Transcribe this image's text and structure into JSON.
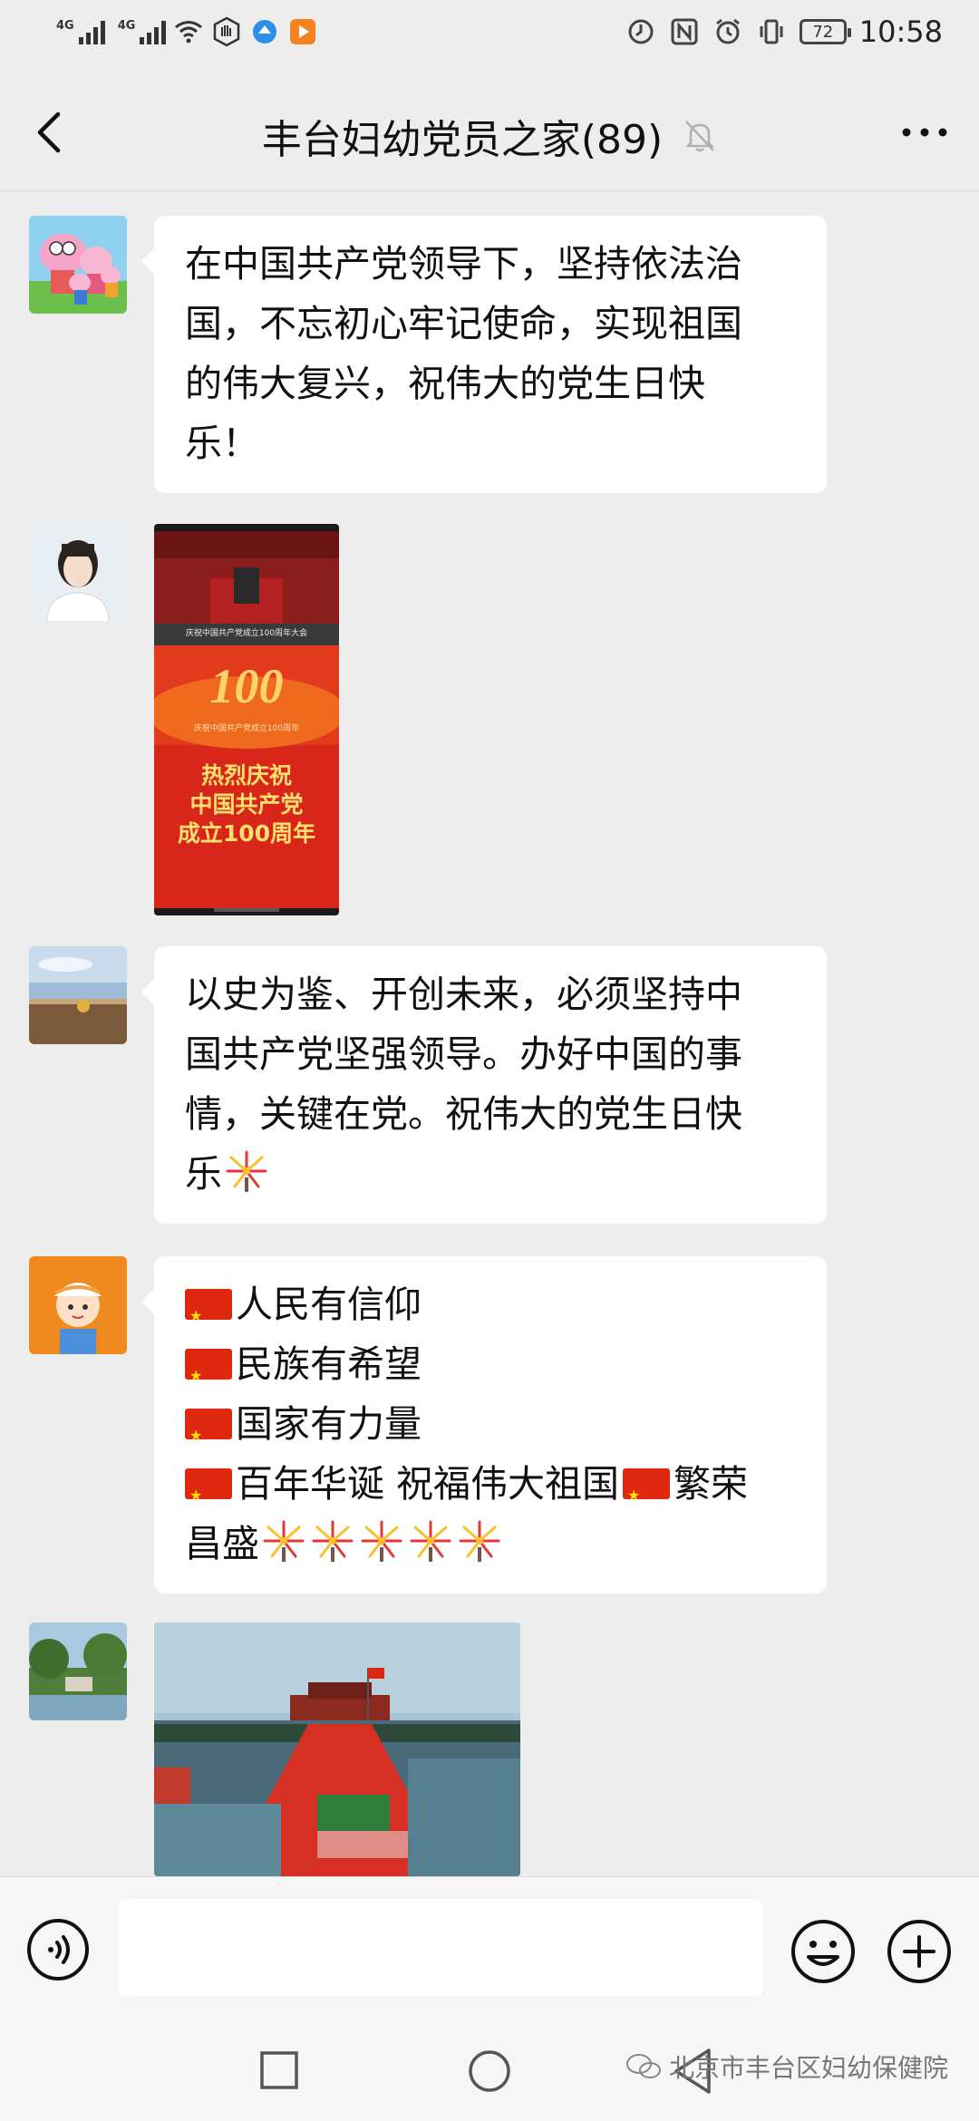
{
  "status_bar": {
    "signal1_label": "4G",
    "signal2_label": "4G",
    "battery": "72",
    "time": "10:58"
  },
  "header": {
    "title": "丰台妇幼党员之家(89)"
  },
  "messages": [
    {
      "type": "text",
      "lines": [
        "在中国共产党领导下，坚持依法治",
        "国，不忘初心牢记使命，实现祖国",
        "的伟大复兴，祝伟大的党生日快",
        "乐！"
      ]
    },
    {
      "type": "image",
      "image": {
        "top_caption": "庆祝中国共产党成立100周年大会",
        "badge": "100",
        "small_text": "庆祝中国共产党成立100周年",
        "headline_lines": [
          "热烈庆祝",
          "中国共产党",
          "成立100周年"
        ]
      }
    },
    {
      "type": "text",
      "lines": [
        "以史为鉴、开创未来，必须坚持中",
        "国共产党坚强领导。办好中国的事",
        "情，关键在党。祝伟大的党生日快",
        "乐"
      ]
    },
    {
      "type": "text",
      "lines": [
        "人民有信仰",
        "民族有希望",
        "国家有力量",
        "百年华诞  祝福伟大祖国",
        "繁荣",
        "昌盛"
      ]
    },
    {
      "type": "image",
      "image": {
        "description": ""
      }
    }
  ],
  "input": {
    "placeholder": ""
  },
  "watermark": "北京市丰台区妇幼保健院",
  "colors": {
    "background": "#ededed",
    "bubble": "#ffffff",
    "flag_red": "#de2910"
  }
}
